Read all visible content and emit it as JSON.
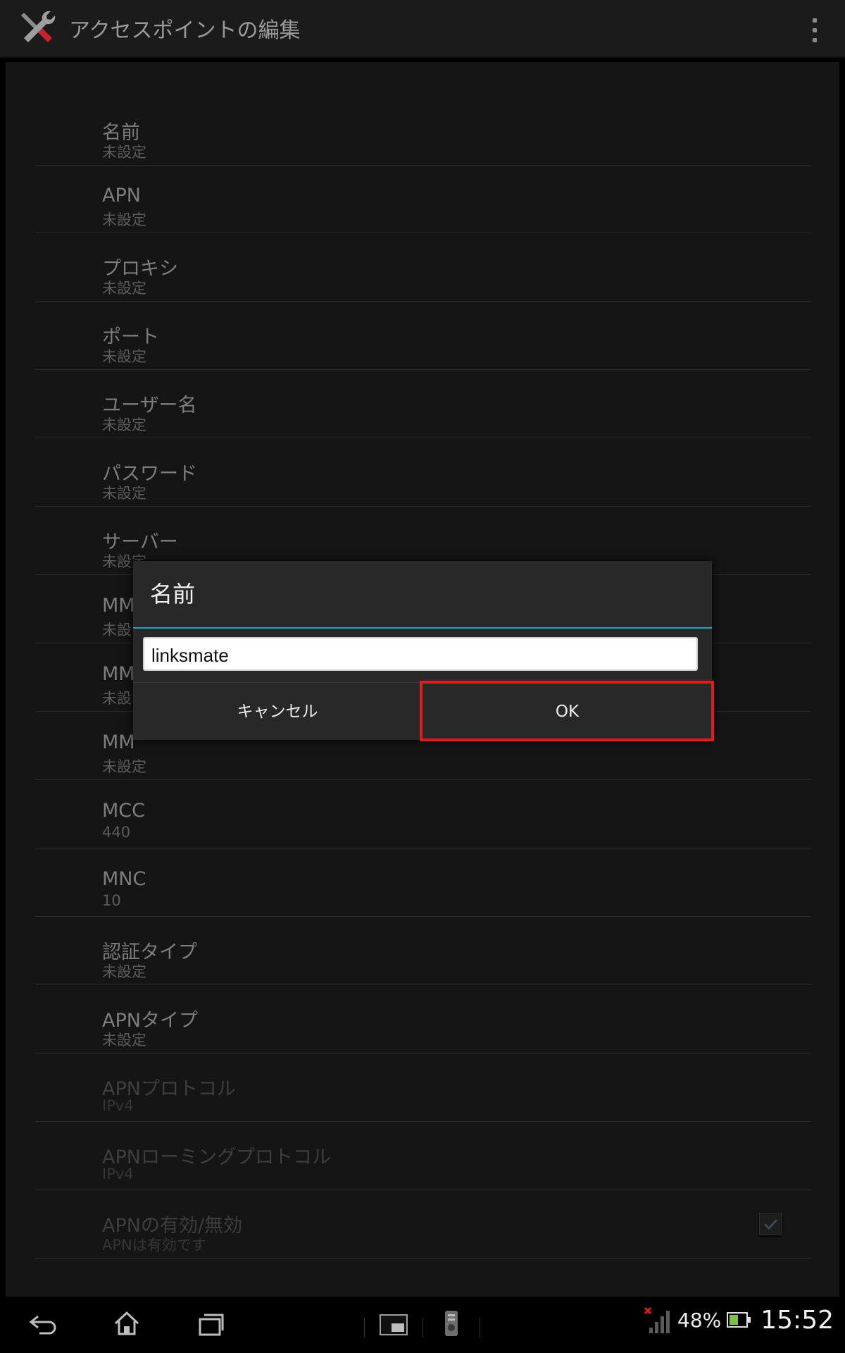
{
  "action_bar": {
    "title": "アクセスポイントの編集"
  },
  "preferences": [
    {
      "title": "名前",
      "summary": "未設定",
      "enabled": true
    },
    {
      "title": "APN",
      "summary": "未設定",
      "enabled": true
    },
    {
      "title": "プロキシ",
      "summary": "未設定",
      "enabled": true
    },
    {
      "title": "ポート",
      "summary": "未設定",
      "enabled": true
    },
    {
      "title": "ユーザー名",
      "summary": "未設定",
      "enabled": true
    },
    {
      "title": "パスワード",
      "summary": "未設定",
      "enabled": true
    },
    {
      "title": "サーバー",
      "summary": "未設定",
      "enabled": true
    },
    {
      "title": "MM",
      "summary": "未設",
      "enabled": true
    },
    {
      "title": "MM",
      "summary": "未設",
      "enabled": true
    },
    {
      "title": "MM",
      "summary": "未設定",
      "enabled": true
    },
    {
      "title": "MCC",
      "summary": "440",
      "enabled": true
    },
    {
      "title": "MNC",
      "summary": "10",
      "enabled": true
    },
    {
      "title": "認証タイプ",
      "summary": "未設定",
      "enabled": true
    },
    {
      "title": "APNタイプ",
      "summary": "未設定",
      "enabled": true
    },
    {
      "title": "APNプロトコル",
      "summary": "IPv4",
      "enabled": false
    },
    {
      "title": "APNローミングプロトコル",
      "summary": "IPv4",
      "enabled": false
    },
    {
      "title": "APNの有効/無効",
      "summary": "APNは有効です",
      "enabled": false,
      "checkbox_checked": true
    }
  ],
  "dialog": {
    "title": "名前",
    "input_value": "linksmate",
    "cancel_label": "キャンセル",
    "ok_label": "OK",
    "accent_color": "#2f9cc4",
    "highlight_color": "#e21b22"
  },
  "status_bar": {
    "battery_percent": "48%",
    "time": "15:52"
  }
}
